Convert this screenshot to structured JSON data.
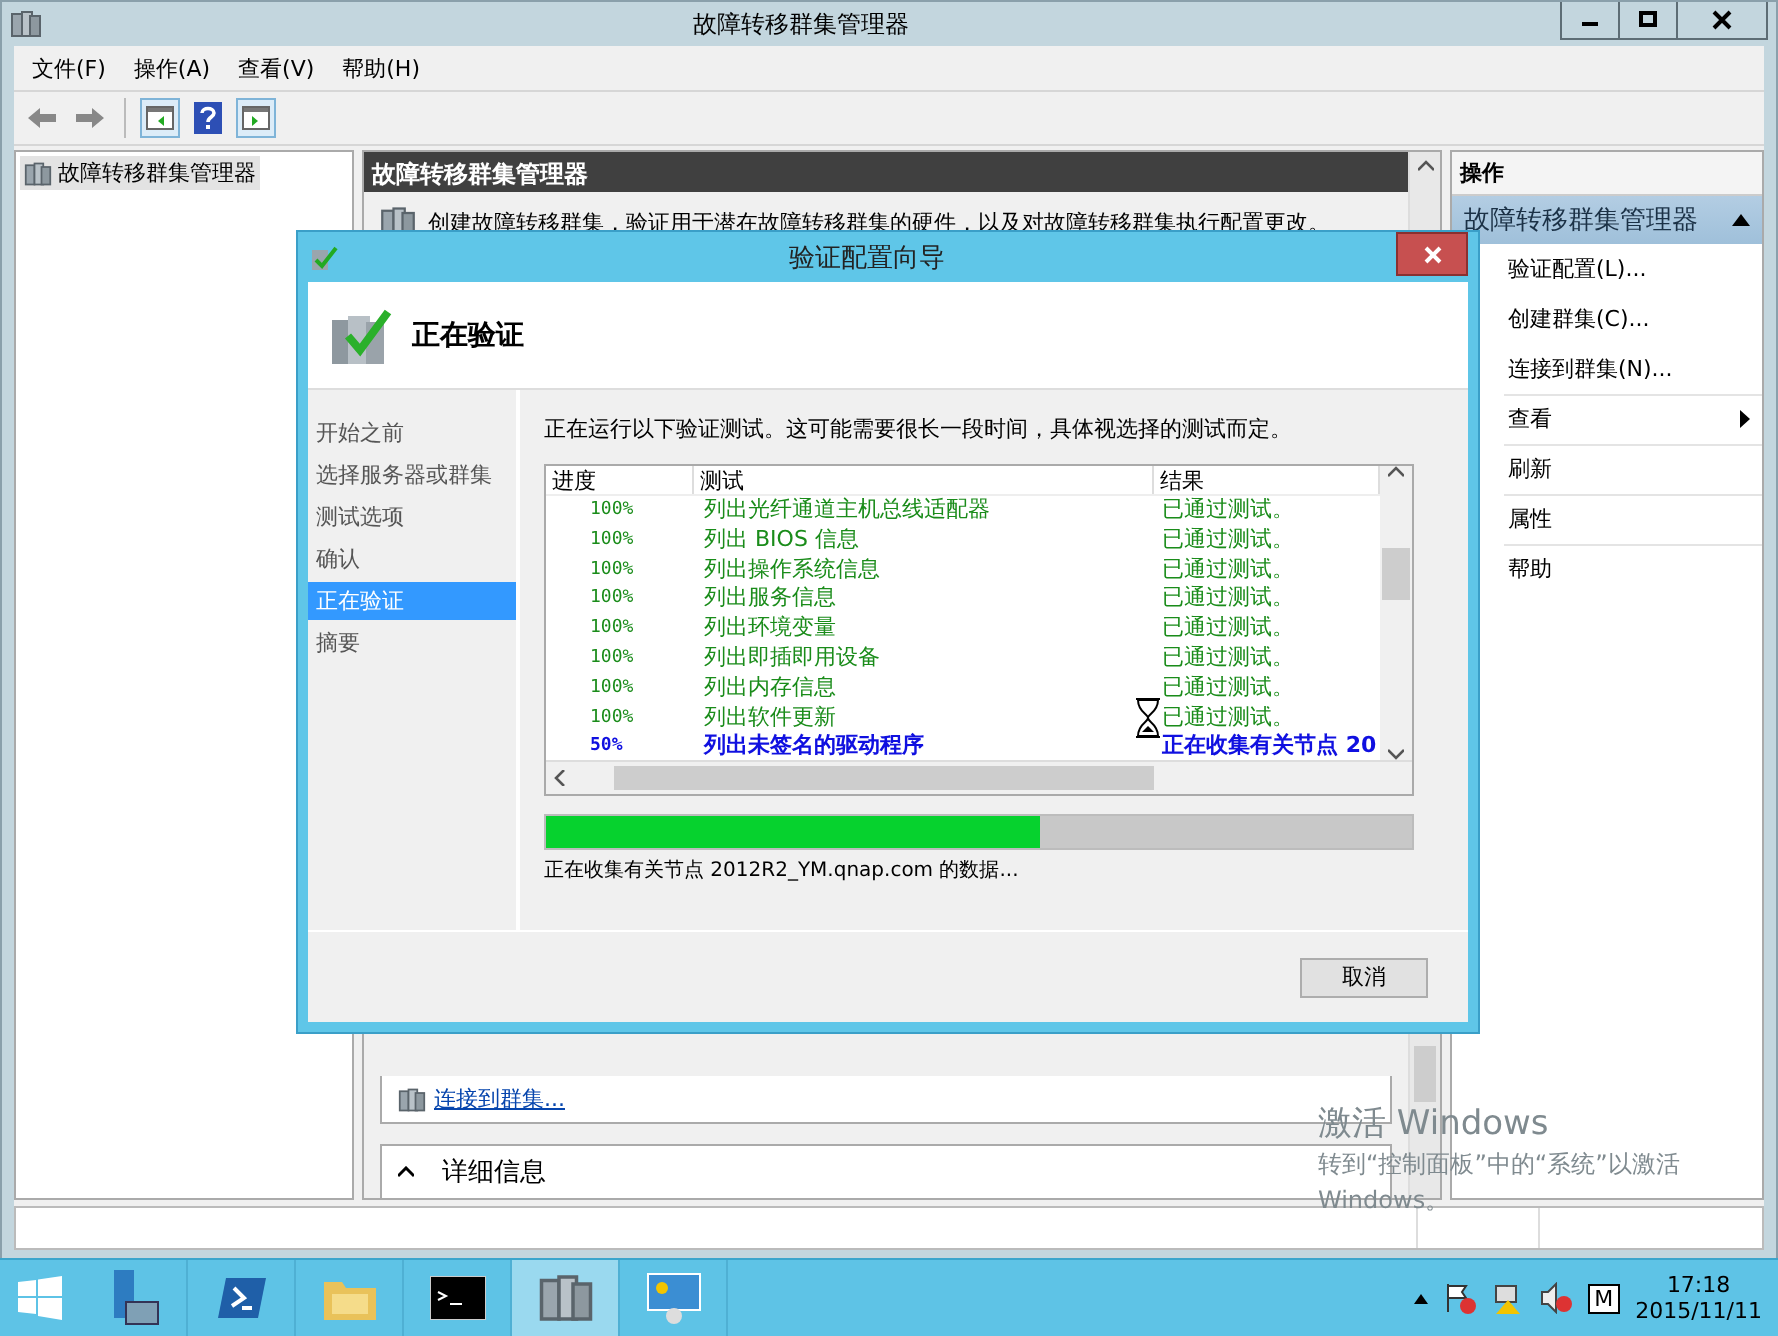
{
  "window": {
    "title": "故障转移群集管理器"
  },
  "menu": [
    {
      "label": "文件(F)"
    },
    {
      "label": "操作(A)"
    },
    {
      "label": "查看(V)"
    },
    {
      "label": "帮助(H)"
    }
  ],
  "tree": {
    "items": [
      {
        "label": "故障转移群集管理器",
        "selected": true
      }
    ]
  },
  "center": {
    "header": "故障转移群集管理器",
    "description": "创建故障转移群集，验证用于潜在故障转移群集的硬件，以及对故障转移群集执行配置更改。",
    "links": [
      {
        "label": "连接到群集..."
      }
    ],
    "section": {
      "title": "详细信息",
      "expanded": true
    }
  },
  "actions": {
    "header": "操作",
    "group": "故障转移群集管理器",
    "items": [
      {
        "label": "验证配置(L)...",
        "has_submenu": false
      },
      {
        "label": "创建群集(C)...",
        "has_submenu": false
      },
      {
        "label": "连接到群集(N)...",
        "has_submenu": false
      },
      {
        "label": "查看",
        "has_submenu": true
      },
      {
        "label": "刷新",
        "has_submenu": false
      },
      {
        "label": "属性",
        "has_submenu": false
      },
      {
        "label": "帮助",
        "has_submenu": false
      }
    ]
  },
  "dialog": {
    "title": "验证配置向导",
    "heading": "正在验证",
    "steps": [
      {
        "label": "开始之前",
        "selected": false
      },
      {
        "label": "选择服务器或群集",
        "selected": false
      },
      {
        "label": "测试选项",
        "selected": false
      },
      {
        "label": "确认",
        "selected": false
      },
      {
        "label": "正在验证",
        "selected": true
      },
      {
        "label": "摘要",
        "selected": false
      }
    ],
    "intro": "正在运行以下验证测试。这可能需要很长一段时间，具体视选择的测试而定。",
    "table": {
      "columns": [
        "进度",
        "测试",
        "结果"
      ],
      "rows": [
        {
          "progress": "100%",
          "test": "列出光纤通道主机总线适配器",
          "result": "已通过测试。",
          "kind": "done"
        },
        {
          "progress": "100%",
          "test": "列出 BIOS 信息",
          "result": "已通过测试。",
          "kind": "done"
        },
        {
          "progress": "100%",
          "test": "列出操作系统信息",
          "result": "已通过测试。",
          "kind": "done"
        },
        {
          "progress": "100%",
          "test": "列出服务信息",
          "result": "已通过测试。",
          "kind": "done"
        },
        {
          "progress": "100%",
          "test": "列出环境变量",
          "result": "已通过测试。",
          "kind": "done"
        },
        {
          "progress": "100%",
          "test": "列出即插即用设备",
          "result": "已通过测试。",
          "kind": "done"
        },
        {
          "progress": "100%",
          "test": "列出内存信息",
          "result": "已通过测试。",
          "kind": "done"
        },
        {
          "progress": "100%",
          "test": "列出软件更新",
          "result": "已通过测试。",
          "kind": "done"
        },
        {
          "progress": "50%",
          "test": "列出未签名的驱动程序",
          "result": "正在收集有关节点 20",
          "kind": "running"
        }
      ]
    },
    "progress": {
      "level": 0.57
    },
    "status_text": "正在收集有关节点 2012R2_YM.qnap.com 的数据...",
    "buttons": [
      "取消"
    ]
  },
  "activation_notice": [
    "激活 Windows",
    "转到“控制面板”中的“系统”以激活",
    "Windows。"
  ],
  "taskbar": {
    "apps": [
      {
        "selected": false
      },
      {
        "selected": false
      },
      {
        "selected": false
      },
      {
        "selected": false
      },
      {
        "selected": true
      },
      {
        "selected": false
      }
    ],
    "tray_label": "M",
    "time": "17:18",
    "date": "2015/11/11"
  }
}
